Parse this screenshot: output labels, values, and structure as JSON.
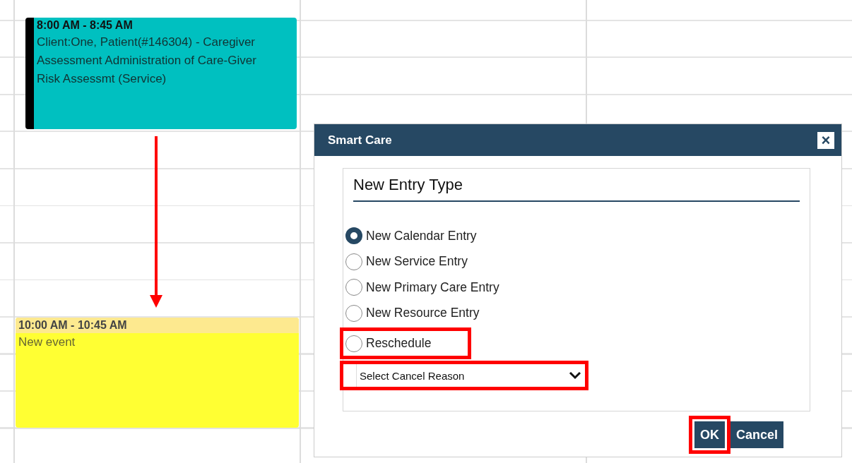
{
  "calendar": {
    "events": [
      {
        "time": "8:00 AM - 8:45 AM",
        "text": "Client:One, Patient(#146304) - Caregiver Assessment Administration of Care-Giver Risk Assessmt (Service)",
        "color": "#00c0c0"
      },
      {
        "time": "10:00 AM - 10:45 AM",
        "text": "New event",
        "color": "#ffff33"
      }
    ]
  },
  "annotations": [
    {
      "kind": "arrow"
    }
  ],
  "dialog": {
    "title": "Smart Care",
    "close": "×",
    "heading": "New Entry Type",
    "options": [
      {
        "label": "New Calendar Entry",
        "selected": true,
        "highlighted": false
      },
      {
        "label": "New Service Entry",
        "selected": false,
        "highlighted": false
      },
      {
        "label": "New Primary Care Entry",
        "selected": false,
        "highlighted": false
      },
      {
        "label": "New Resource Entry",
        "selected": false,
        "highlighted": false
      },
      {
        "label": "Reschedule",
        "selected": false,
        "highlighted": true
      }
    ],
    "select": {
      "value": "Select Cancel Reason",
      "highlighted": true
    },
    "buttons": [
      {
        "label": "OK",
        "highlighted": true
      },
      {
        "label": "Cancel",
        "highlighted": false
      }
    ]
  }
}
